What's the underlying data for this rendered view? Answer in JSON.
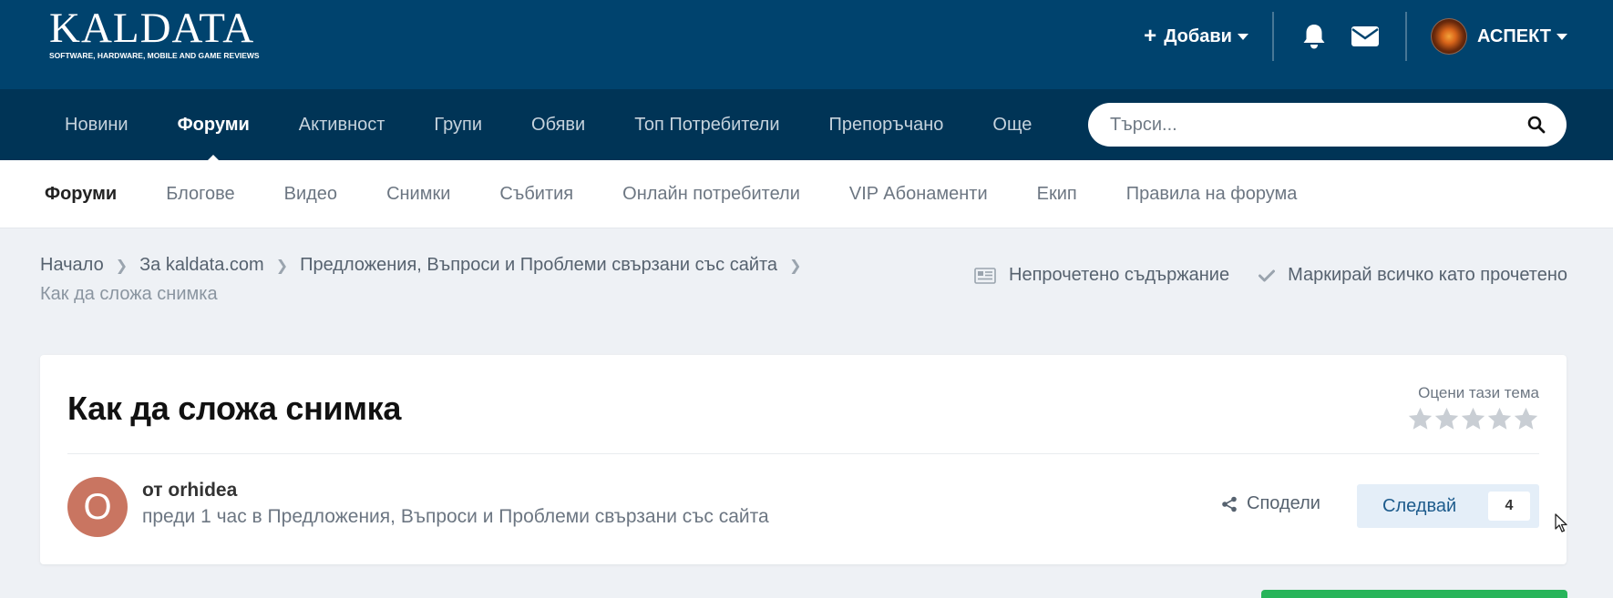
{
  "logo": {
    "main": "KALDATA",
    "tagline": "SOFTWARE, HARDWARE, MOBILE AND GAME REVIEWS"
  },
  "user_bar": {
    "add_label": "Добави",
    "notifications_icon": "bell-icon",
    "messages_icon": "envelope-icon",
    "username": "АСПЕКТ"
  },
  "primary_nav": {
    "items": [
      "Новини",
      "Форуми",
      "Активност",
      "Групи",
      "Обяви",
      "Топ Потребители",
      "Препоръчано",
      "Още"
    ],
    "active_index": 1
  },
  "search": {
    "placeholder": "Търси..."
  },
  "secondary_nav": {
    "items": [
      "Форуми",
      "Блогове",
      "Видео",
      "Снимки",
      "Събития",
      "Онлайн потребители",
      "VIP Абонаменти",
      "Екип",
      "Правила на форума"
    ],
    "active_index": 0
  },
  "breadcrumb": {
    "items": [
      "Начало",
      "За kaldata.com",
      "Предложения, Въпроси и Проблеми свързани със сайта"
    ],
    "current": "Как да сложа снимка"
  },
  "page_actions": {
    "unread": "Непрочетено съдържание",
    "mark_read": "Маркирай всичко като прочетено"
  },
  "topic": {
    "title": "Как да сложа снимка",
    "rate_label": "Оцени тази тема",
    "rating_stars": 5,
    "rating_value": 0,
    "author_initial": "O",
    "author_line": "от orhidea",
    "meta_line": "преди 1 час в Предложения, Въпроси и Проблеми свързани със сайта",
    "share_label": "Сподели",
    "follow_label": "Следвай",
    "follow_count": "4"
  },
  "colors": {
    "header_bg": "#00436e",
    "nav_bg": "#003456",
    "avatar_bg": "#c97561",
    "follow_bg": "#e4eef8",
    "green_button": "#28b45a"
  }
}
